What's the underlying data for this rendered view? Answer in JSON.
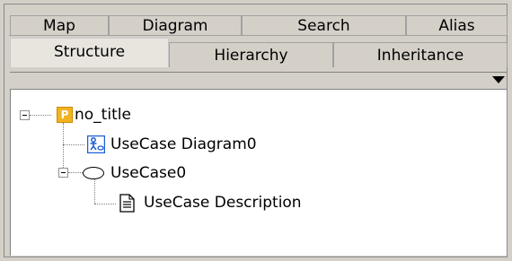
{
  "tabs_top": [
    {
      "label": "Map"
    },
    {
      "label": "Diagram"
    },
    {
      "label": "Search"
    },
    {
      "label": "Alias"
    }
  ],
  "tabs_bottom": [
    {
      "label": "Structure",
      "active": true
    },
    {
      "label": "Hierarchy",
      "active": false
    },
    {
      "label": "Inheritance",
      "active": false
    }
  ],
  "tree": {
    "root": {
      "label": "no_title",
      "icon": "package-icon",
      "expanded": true
    },
    "diagram": {
      "label": "UseCase Diagram0",
      "icon": "usecase-diagram-icon"
    },
    "usecase": {
      "label": "UseCase0",
      "icon": "usecase-oval-icon",
      "expanded": true
    },
    "description": {
      "label": "UseCase Description",
      "icon": "document-icon"
    }
  },
  "colors": {
    "background": "#d4d0c8",
    "tree_background": "#ffffff",
    "package_icon": "#f0b420",
    "diagram_icon": "#1f5fd6"
  }
}
